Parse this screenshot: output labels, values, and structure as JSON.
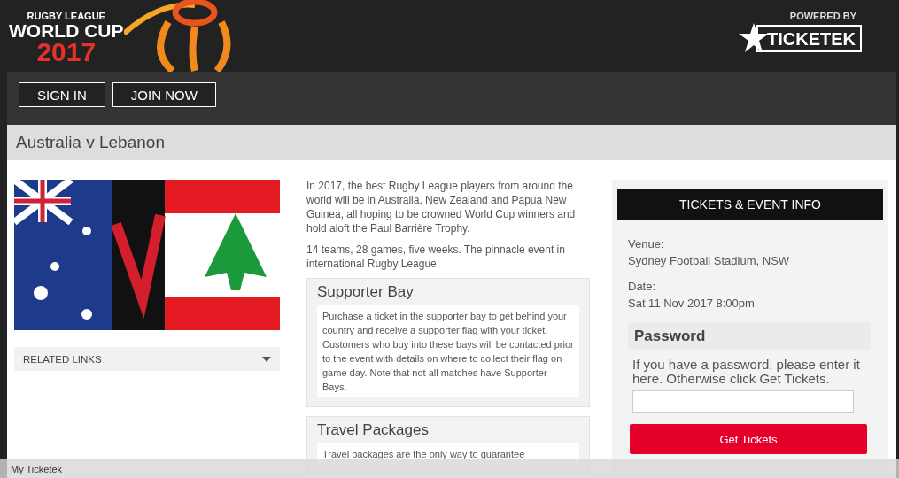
{
  "header": {
    "logo": {
      "line1": "RUGBY LEAGUE",
      "line2": "WORLD CUP",
      "year": "2017"
    },
    "powered_by": "POWERED BY",
    "brand": "TICKETEK"
  },
  "nav": {
    "buttons": [
      "SIGN IN",
      "JOIN NOW"
    ]
  },
  "event_title": "Australia v Lebanon",
  "related_links": {
    "label": "RELATED LINKS",
    "expanded": false
  },
  "intro": [
    "In 2017, the best Rugby League players from around the world will be in Australia, New Zealand and Papua New Guinea, all hoping to be crowned World Cup winners and hold aloft the Paul Barrière Trophy.",
    "14 teams, 28 games, five weeks. The pinnacle event in international Rugby League."
  ],
  "panels": [
    {
      "title": "Supporter Bay",
      "body": "Purchase a ticket in the supporter bay to get behind your country and receive a supporter flag with your ticket. Customers who buy into these bays will be contacted prior to the event with details on where to collect their flag on game day. Note that not all matches have Supporter Bays."
    },
    {
      "title": "Travel Packages",
      "body": "Travel packages are the only way to guarantee"
    }
  ],
  "tickets": {
    "header": "TICKETS & EVENT INFO",
    "details": [
      {
        "label": "Venue:",
        "value": "Sydney Football Stadium, NSW"
      },
      {
        "label": "Date:",
        "value": "Sat 11 Nov 2017 8:00pm"
      }
    ],
    "password": {
      "title": "Password",
      "hint": "If you have a password, please enter it here. Otherwise click Get Tickets."
    },
    "button": "Get Tickets"
  },
  "footer_bar": {
    "label": "My Ticketek"
  }
}
